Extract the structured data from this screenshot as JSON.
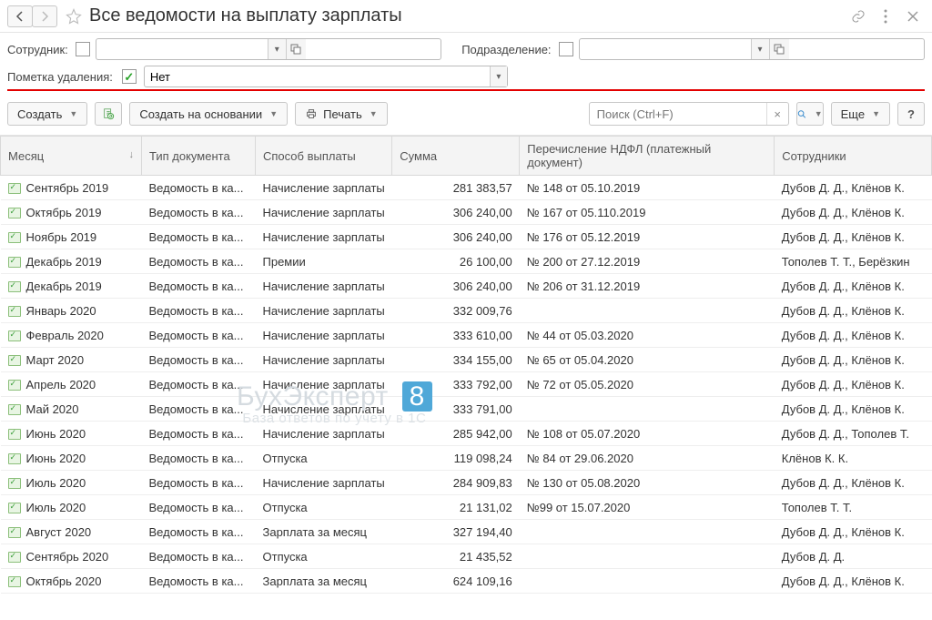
{
  "header": {
    "title": "Все ведомости на выплату зарплаты"
  },
  "filters": {
    "employee_label": "Сотрудник:",
    "employee_value": "",
    "department_label": "Подразделение:",
    "department_value": "",
    "deletion_mark_label": "Пометка удаления:",
    "deletion_mark_value": "Нет",
    "deletion_mark_checked": true
  },
  "toolbar": {
    "create_label": "Создать",
    "create_based_on_label": "Создать на основании",
    "print_label": "Печать",
    "search_placeholder": "Поиск (Ctrl+F)",
    "more_label": "Еще"
  },
  "columns": {
    "month": "Месяц",
    "doc_type": "Тип документа",
    "pay_method": "Способ выплаты",
    "sum": "Сумма",
    "ndfl": "Перечисление НДФЛ (платежный документ)",
    "employees": "Сотрудники"
  },
  "rows": [
    {
      "month": "Сентябрь 2019",
      "doc_type": "Ведомость в ка...",
      "pay_method": "Начисление зарплаты",
      "sum": "281 383,57",
      "ndfl": "№ 148 от 05.10.2019",
      "employees": "Дубов Д. Д., Клёнов К."
    },
    {
      "month": "Октябрь 2019",
      "doc_type": "Ведомость в ка...",
      "pay_method": "Начисление зарплаты",
      "sum": "306 240,00",
      "ndfl": "№ 167 от 05.110.2019",
      "employees": "Дубов Д. Д., Клёнов К."
    },
    {
      "month": "Ноябрь 2019",
      "doc_type": "Ведомость в ка...",
      "pay_method": "Начисление зарплаты",
      "sum": "306 240,00",
      "ndfl": "№ 176 от 05.12.2019",
      "employees": "Дубов Д. Д., Клёнов К."
    },
    {
      "month": "Декабрь 2019",
      "doc_type": "Ведомость в ка...",
      "pay_method": "Премии",
      "sum": "26 100,00",
      "ndfl": "№ 200 от 27.12.2019",
      "employees": "Тополев Т. Т., Берёзкин"
    },
    {
      "month": "Декабрь 2019",
      "doc_type": "Ведомость в ка...",
      "pay_method": "Начисление зарплаты",
      "sum": "306 240,00",
      "ndfl": "№ 206 от 31.12.2019",
      "employees": "Дубов Д. Д., Клёнов К."
    },
    {
      "month": "Январь 2020",
      "doc_type": "Ведомость в ка...",
      "pay_method": "Начисление зарплаты",
      "sum": "332 009,76",
      "ndfl": "",
      "employees": "Дубов Д. Д., Клёнов К."
    },
    {
      "month": "Февраль 2020",
      "doc_type": "Ведомость в ка...",
      "pay_method": "Начисление зарплаты",
      "sum": "333 610,00",
      "ndfl": "№ 44 от 05.03.2020",
      "employees": "Дубов Д. Д., Клёнов К."
    },
    {
      "month": "Март 2020",
      "doc_type": "Ведомость в ка...",
      "pay_method": "Начисление зарплаты",
      "sum": "334 155,00",
      "ndfl": "№ 65 от 05.04.2020",
      "employees": "Дубов Д. Д., Клёнов К."
    },
    {
      "month": "Апрель 2020",
      "doc_type": "Ведомость в ка...",
      "pay_method": "Начисление зарплаты",
      "sum": "333 792,00",
      "ndfl": "№ 72 от 05.05.2020",
      "employees": "Дубов Д. Д., Клёнов К."
    },
    {
      "month": "Май 2020",
      "doc_type": "Ведомость в ка...",
      "pay_method": "Начисление зарплаты",
      "sum": "333 791,00",
      "ndfl": "",
      "employees": "Дубов Д. Д., Клёнов К."
    },
    {
      "month": "Июнь 2020",
      "doc_type": "Ведомость в ка...",
      "pay_method": "Начисление зарплаты",
      "sum": "285 942,00",
      "ndfl": "№ 108 от 05.07.2020",
      "employees": "Дубов Д. Д., Тополев Т."
    },
    {
      "month": "Июнь 2020",
      "doc_type": "Ведомость в ка...",
      "pay_method": "Отпуска",
      "sum": "119 098,24",
      "ndfl": "№ 84 от 29.06.2020",
      "employees": "Клёнов К. К."
    },
    {
      "month": "Июль 2020",
      "doc_type": "Ведомость в ка...",
      "pay_method": "Начисление зарплаты",
      "sum": "284 909,83",
      "ndfl": "№ 130 от 05.08.2020",
      "employees": "Дубов Д. Д., Клёнов К."
    },
    {
      "month": "Июль 2020",
      "doc_type": "Ведомость в ка...",
      "pay_method": "Отпуска",
      "sum": "21 131,02",
      "ndfl": "№99 от 15.07.2020",
      "employees": "Тополев Т. Т."
    },
    {
      "month": "Август 2020",
      "doc_type": "Ведомость в ка...",
      "pay_method": "Зарплата за месяц",
      "sum": "327 194,40",
      "ndfl": "",
      "employees": "Дубов Д. Д., Клёнов К."
    },
    {
      "month": "Сентябрь 2020",
      "doc_type": "Ведомость в ка...",
      "pay_method": "Отпуска",
      "sum": "21 435,52",
      "ndfl": "",
      "employees": "Дубов Д. Д."
    },
    {
      "month": "Октябрь 2020",
      "doc_type": "Ведомость в ка...",
      "pay_method": "Зарплата за месяц",
      "sum": "624 109,16",
      "ndfl": "",
      "employees": "Дубов Д. Д., Клёнов К."
    }
  ],
  "watermark": {
    "main": "БухЭксперт",
    "badge": "8",
    "sub": "База ответов по учету в 1С"
  }
}
